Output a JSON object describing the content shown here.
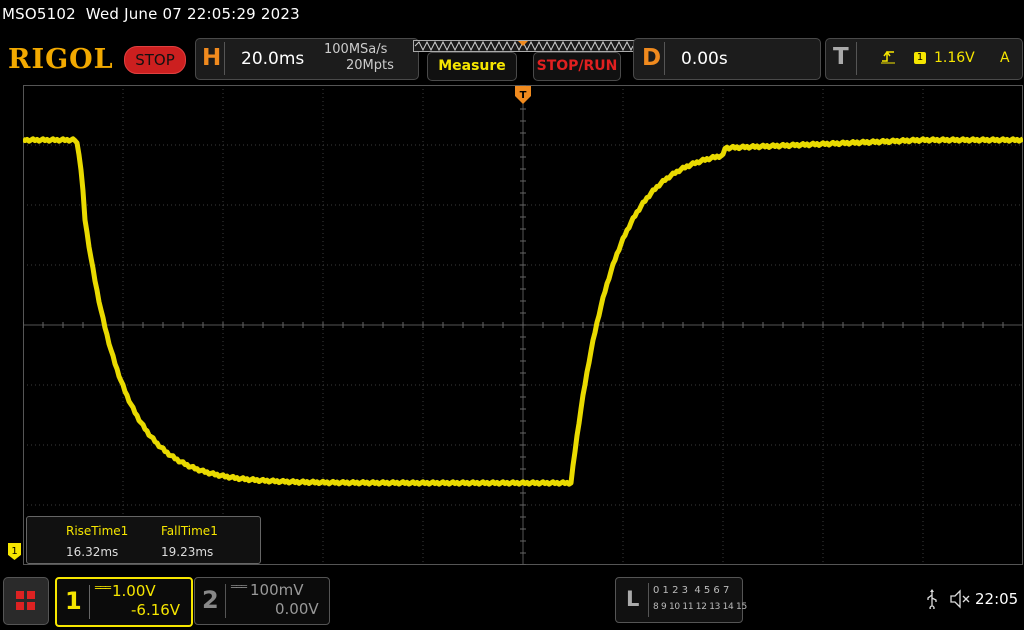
{
  "header": {
    "model": "MSO5102",
    "datetime": "Wed June 07 22:05:29 2023",
    "brand": "RIGOL",
    "run_state": "STOP"
  },
  "horizontal": {
    "letter": "H",
    "timebase": "20.0ms",
    "sample_rate": "100MSa/s",
    "memory_depth": "20Mpts"
  },
  "buttons": {
    "measure": "Measure",
    "stop_run": "STOP/RUN"
  },
  "delay": {
    "letter": "D",
    "value": "0.00s"
  },
  "trigger": {
    "letter": "T",
    "source": "1",
    "level": "1.16V",
    "mode": "A",
    "marker_label": "T"
  },
  "measurements": [
    {
      "label": "RiseTime1",
      "value": "16.32ms"
    },
    {
      "label": "FallTime1",
      "value": "19.23ms"
    }
  ],
  "channels": [
    {
      "number": "1",
      "scale": "1.00V",
      "offset": "-6.16V",
      "color": "#f6e600",
      "active": true
    },
    {
      "number": "2",
      "scale": "100mV",
      "offset": "0.00V",
      "color": "#888888",
      "active": false
    }
  ],
  "channel1_marker": "1",
  "logic": {
    "letter": "L",
    "row1": "0 1 2 3  4 5 6 7",
    "row2": "8 9 10 11 12 13 14 15"
  },
  "status": {
    "clock": "22:05",
    "usb_icon": "usb-icon",
    "sound_icon": "speaker-muted-icon"
  },
  "colors": {
    "trace": "#f6e600",
    "accent": "#f08a1e",
    "stop": "#cc1f1f",
    "grid": "#3a3a3a"
  }
}
